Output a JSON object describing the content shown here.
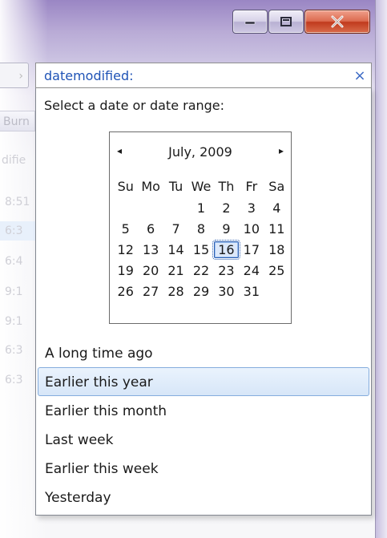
{
  "window": {
    "minimize_icon": "minimize-icon",
    "maximize_icon": "maximize-icon",
    "close_icon": "close-icon",
    "close_color": "#c03a1d"
  },
  "background": {
    "toolbar_fragment": "Burn",
    "column_fragment": "difie",
    "time_fragments": [
      "8:51",
      "6:3",
      "6:4",
      "9:1",
      "9:1",
      "6:3",
      "6:3"
    ]
  },
  "search": {
    "value": "datemodified:",
    "clear_label": "×"
  },
  "dropdown": {
    "header": "Select a date or date range:",
    "calendar": {
      "title": "July, 2009",
      "prev_icon": "◂",
      "next_icon": "▸",
      "weekdays": [
        "Su",
        "Mo",
        "Tu",
        "We",
        "Th",
        "Fr",
        "Sa"
      ],
      "weeks": [
        [
          "",
          "",
          "",
          "1",
          "2",
          "3",
          "4"
        ],
        [
          "5",
          "6",
          "7",
          "8",
          "9",
          "10",
          "11"
        ],
        [
          "12",
          "13",
          "14",
          "15",
          "16",
          "17",
          "18"
        ],
        [
          "19",
          "20",
          "21",
          "22",
          "23",
          "24",
          "25"
        ],
        [
          "26",
          "27",
          "28",
          "29",
          "30",
          "31",
          ""
        ]
      ],
      "today": "16"
    },
    "options": [
      "A long time ago",
      "Earlier this year",
      "Earlier this month",
      "Last week",
      "Earlier this week",
      "Yesterday"
    ],
    "highlighted_option": "Earlier this year"
  }
}
